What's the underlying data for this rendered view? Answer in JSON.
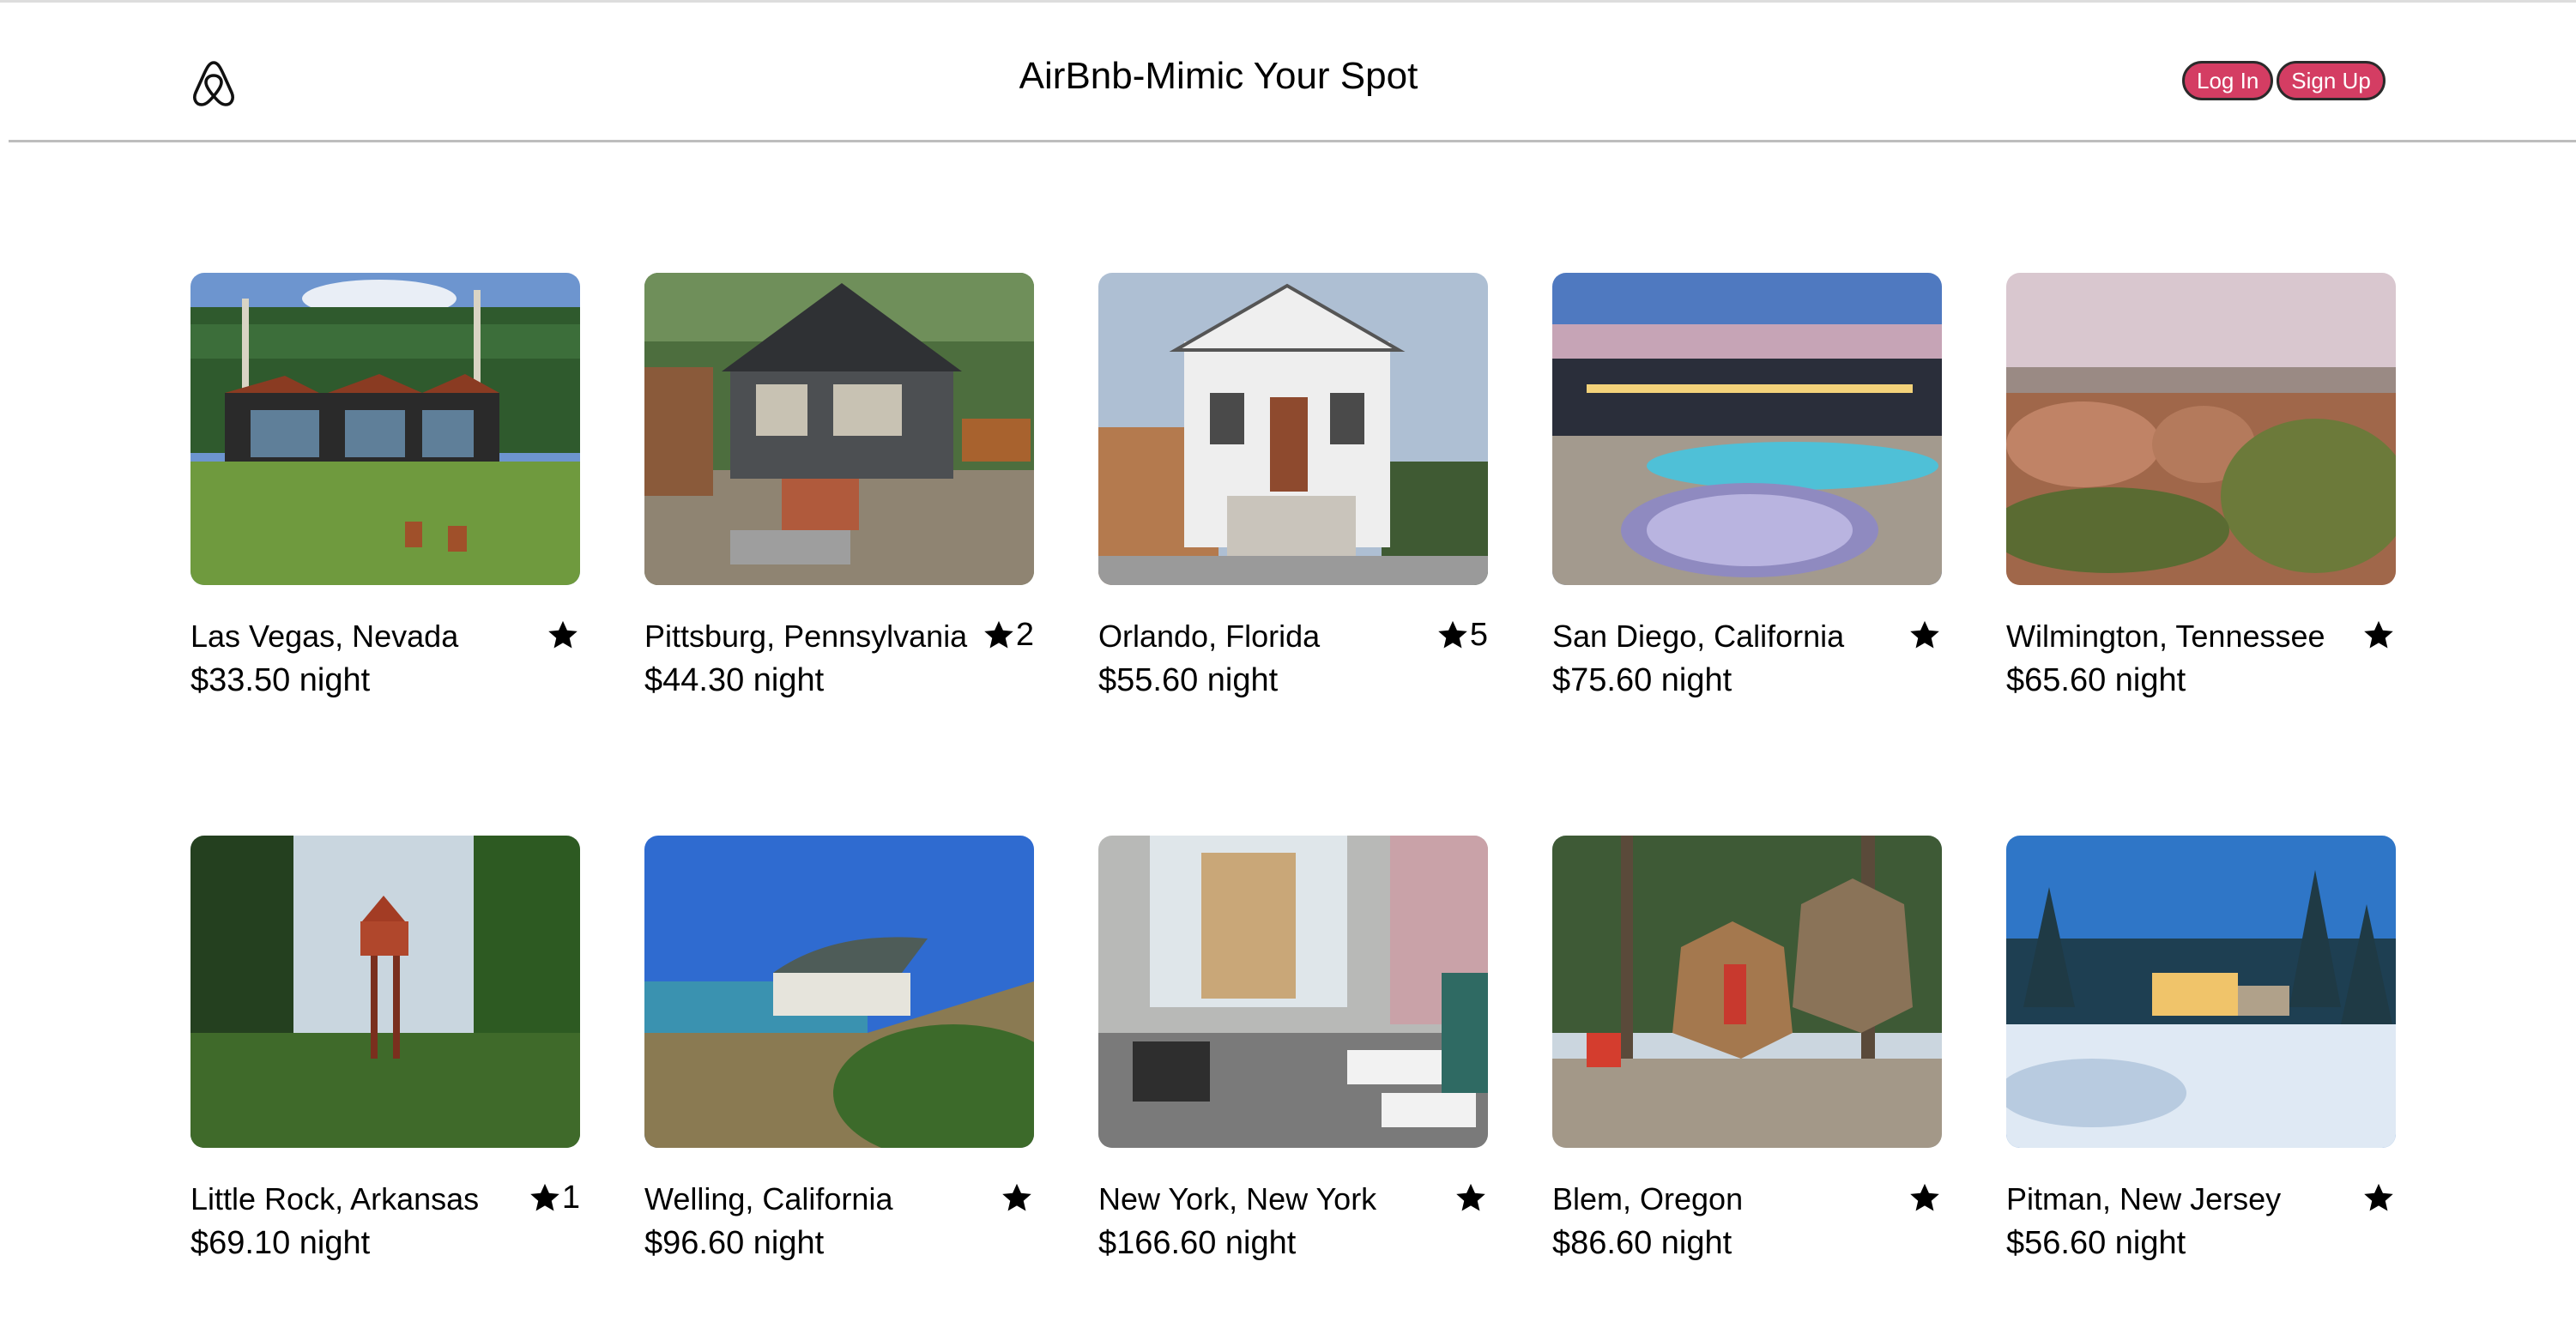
{
  "header": {
    "title": "AirBnb-Mimic Your Spot",
    "login_label": "Log In",
    "signup_label": "Sign Up",
    "logo_icon": "airbnb-logo-icon",
    "accent_color": "#d43d63"
  },
  "listings": [
    {
      "location": "Las Vegas, Nevada",
      "price": "$33.50 night",
      "rating": "",
      "scene": "red-cabins-meadow"
    },
    {
      "location": "Pittsburg, Pennsylvania",
      "price": "$44.30 night",
      "rating": "2",
      "scene": "gray-bungalow-garden"
    },
    {
      "location": "Orlando, Florida",
      "price": "$55.60 night",
      "rating": "5",
      "scene": "white-cottage-porch"
    },
    {
      "location": "San Diego, California",
      "price": "$75.60 night",
      "rating": "",
      "scene": "pool-hot-tub-dusk"
    },
    {
      "location": "Wilmington, Tennessee",
      "price": "$65.60 night",
      "rating": "",
      "scene": "desert-dome-home"
    },
    {
      "location": "Little Rock, Arkansas",
      "price": "$69.10 night",
      "rating": "1",
      "scene": "treehouse-tower-forest"
    },
    {
      "location": "Welling, California",
      "price": "$96.60 night",
      "rating": "",
      "scene": "cliffside-house-ocean"
    },
    {
      "location": "New York, New York",
      "price": "$166.60 night",
      "rating": "",
      "scene": "hotel-lounge-interior"
    },
    {
      "location": "Blem, Oregon",
      "price": "$86.60 night",
      "rating": "",
      "scene": "geodesic-pod-woods"
    },
    {
      "location": "Pitman, New Jersey",
      "price": "$56.60 night",
      "rating": "",
      "scene": "snowy-house-pines"
    }
  ]
}
